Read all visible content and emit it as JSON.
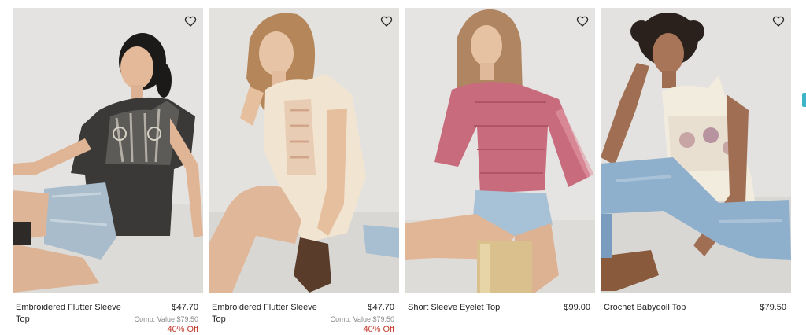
{
  "products": [
    {
      "name": "Embroidered Flutter Sleeve Top",
      "price": "$47.70",
      "comp_label": "Comp. Value",
      "comp_value": "$79.50",
      "discount": "40% Off",
      "wishlist_icon": "heart-outline-icon"
    },
    {
      "name": "Embroidered Flutter Sleeve Top",
      "price": "$47.70",
      "comp_label": "Comp. Value",
      "comp_value": "$79.50",
      "discount": "40% Off",
      "wishlist_icon": "heart-outline-icon"
    },
    {
      "name": "Short Sleeve Eyelet Top",
      "price": "$99.00",
      "wishlist_icon": "heart-outline-icon"
    },
    {
      "name": "Crochet Babydoll Top",
      "price": "$79.50",
      "wishlist_icon": "heart-outline-icon"
    }
  ],
  "colors": {
    "discount": "#c0392b",
    "comp_value": "#8a8a8a",
    "text": "#222222"
  }
}
